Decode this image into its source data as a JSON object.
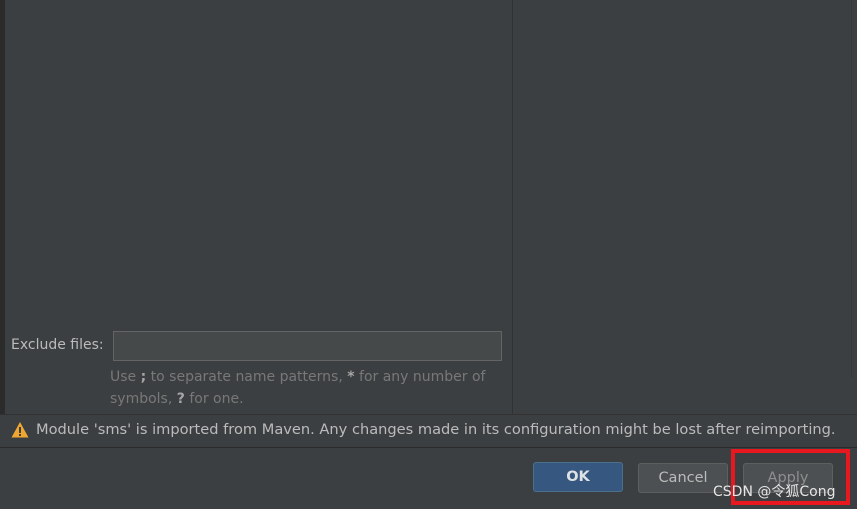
{
  "exclude": {
    "label": "Exclude files:",
    "value": "",
    "placeholder": "",
    "hint_use": "Use",
    "hint_sep": ";",
    "hint_mid": "to separate name patterns,",
    "hint_star": "*",
    "hint_after": "for any number of symbols,",
    "hint_q": "?",
    "hint_end": "for one."
  },
  "warning": {
    "icon": "warning-icon",
    "text": "Module 'sms' is imported from Maven. Any changes made in its configuration might be lost after reimporting."
  },
  "buttons": {
    "ok": "OK",
    "cancel": "Cancel",
    "apply": "Apply"
  },
  "watermark": "CSDN @令狐Cong",
  "colors": {
    "background": "#3c3f41",
    "ok_button": "#365880",
    "highlight": "#e8181e",
    "warning_icon": "#f0a732"
  }
}
